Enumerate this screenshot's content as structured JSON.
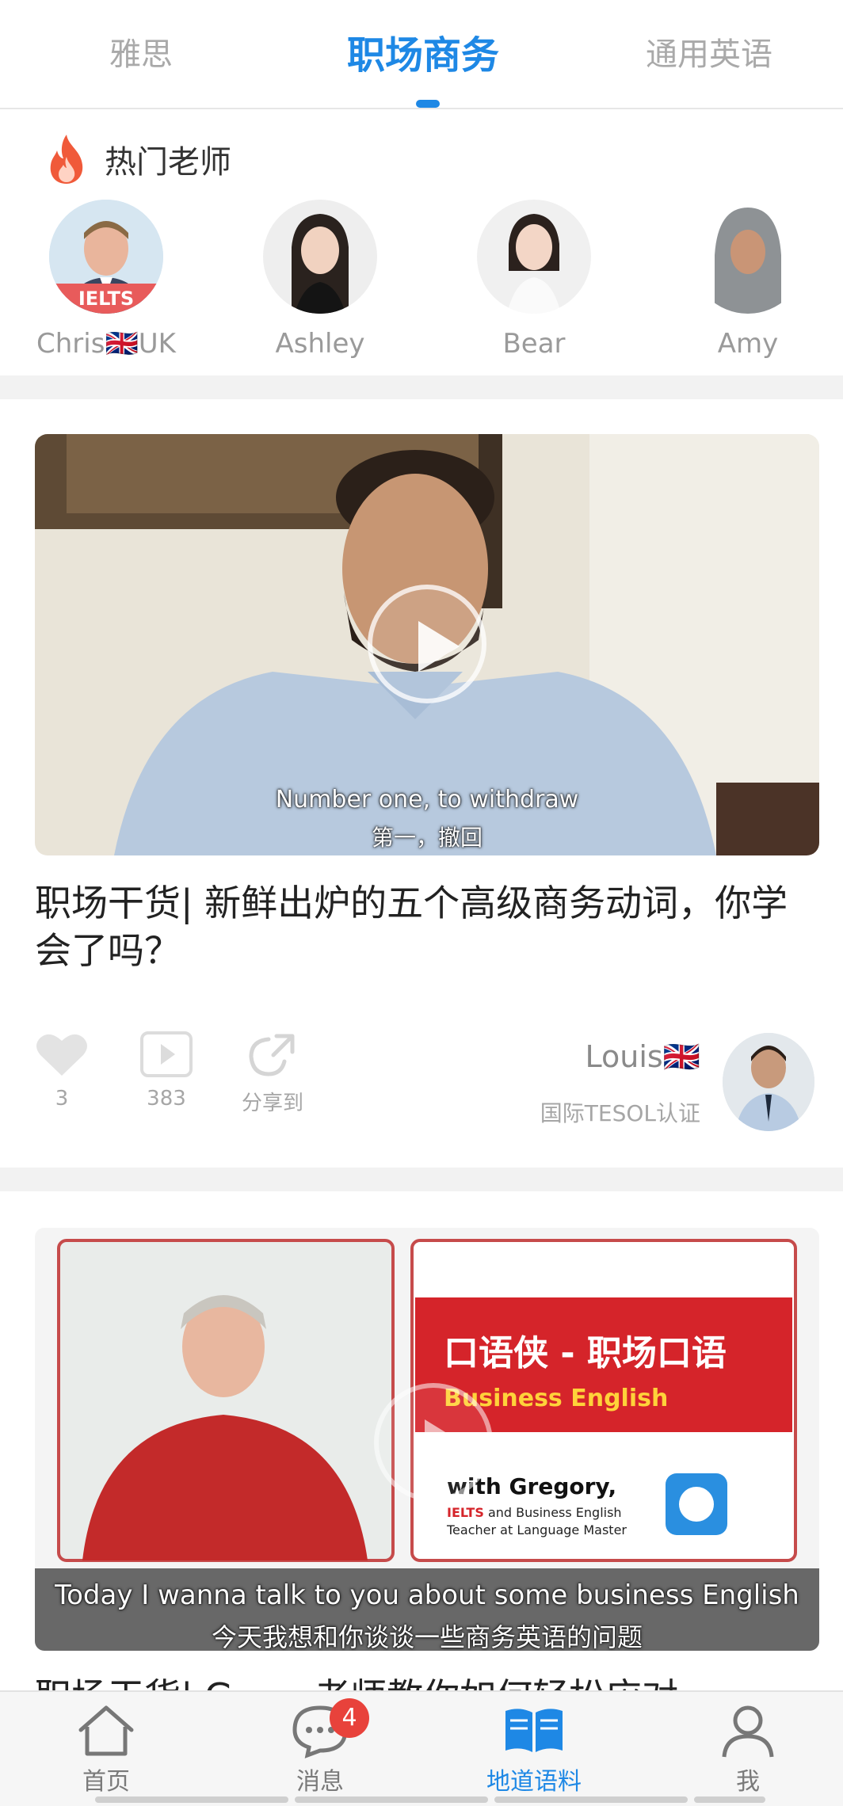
{
  "top_tabs": [
    {
      "label": "雅思"
    },
    {
      "label": "职场商务"
    },
    {
      "label": "通用英语"
    }
  ],
  "hot_teachers": {
    "title": "热门老师",
    "items": [
      {
        "name": "Chris🇬🇧UK",
        "badge": "IELTS"
      },
      {
        "name": "Ashley"
      },
      {
        "name": "Bear"
      },
      {
        "name": "Amy"
      }
    ]
  },
  "posts": [
    {
      "subtitle_en": "Number one, to withdraw",
      "subtitle_zh": "第一，撤回",
      "title": "职场干货| 新鲜出炉的五个高级商务动词，你学会了吗？",
      "likes": "3",
      "plays": "383",
      "share_label": "分享到",
      "author": "Louis🇬🇧",
      "author_cert": "国际TESOL认证"
    },
    {
      "card_title": "口语侠 - 职场口语",
      "card_subtitle": "Business English",
      "card_with": "with Gregory,",
      "card_desc_highlight": "IELTS",
      "card_desc_rest": " and Business English",
      "card_desc_line2": "Teacher at Language Master",
      "subtitle_en": "Today I wanna talk to you about some business English",
      "subtitle_zh": "今天我想和你谈谈一些商务英语的问题",
      "title": "职场干货| G...... 老师教你如何轻松应对"
    }
  ],
  "bottom_nav": [
    {
      "label": "首页",
      "icon": "home-icon"
    },
    {
      "label": "消息",
      "icon": "message-icon",
      "badge": "4"
    },
    {
      "label": "地道语料",
      "icon": "book-icon"
    },
    {
      "label": "我",
      "icon": "user-icon"
    }
  ],
  "colors": {
    "accent": "#1e88e5",
    "badge": "#e8423b",
    "ielts_band": "#e85b5b"
  }
}
